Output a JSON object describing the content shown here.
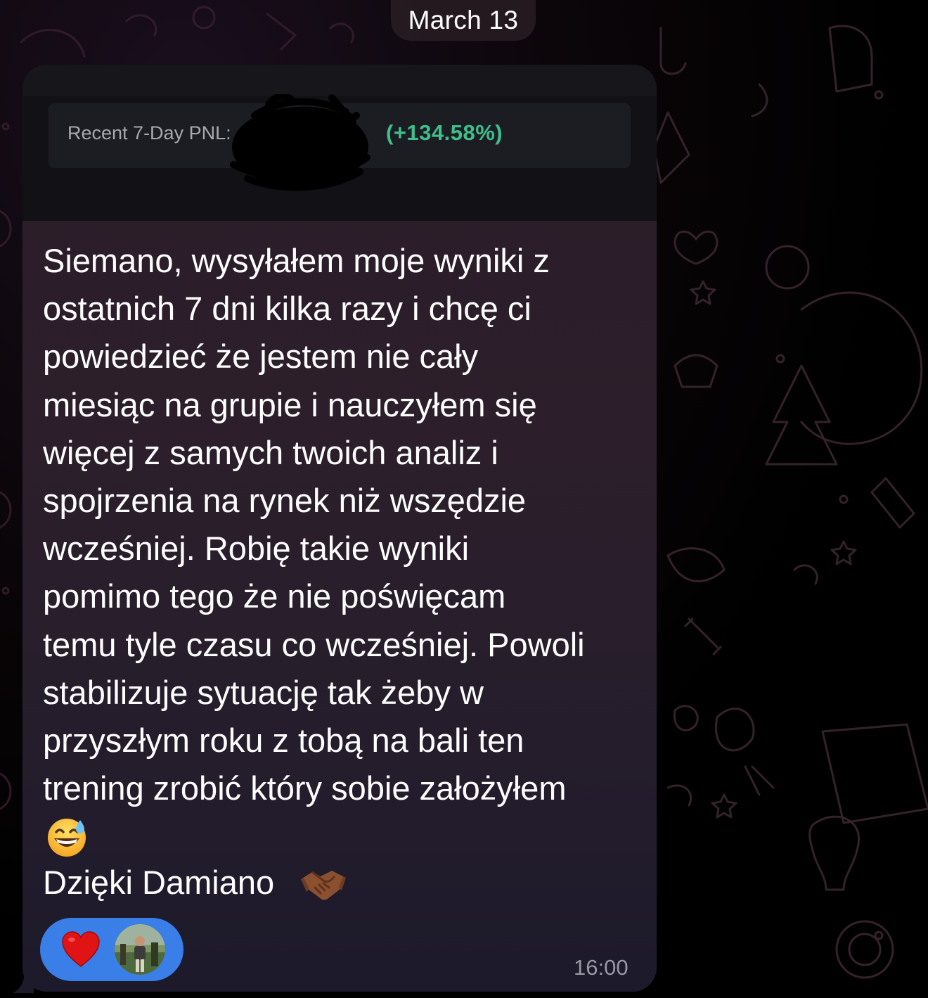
{
  "chat": {
    "date_label": "March 13"
  },
  "message": {
    "attachment": {
      "pnl_label": "Recent 7-Day PNL:",
      "pnl_percent": "(+134.58%)"
    },
    "text": "Siemano, wysyłałem moje wyniki z\nostatnich 7 dni kilka razy i chcę ci\npowiedzieć że jestem nie cały\nmiesiąc na grupie i nauczyłem się\nwięcej z samych twoich analiz i\nspojrzenia na rynek niż wszędzie\nwcześniej. Robię takie wyniki\npomimo tego że nie poświęcam\ntemu tyle czasu co wcześniej. Powoli\nstabilizuje sytuację tak żeby w\nprzyszłym roku z tobą na bali ten\ntrening zrobić który sobie założyłem",
    "emoji_1": "grinning-face-with-sweat-emoji",
    "thanks": "Dzięki Damiano",
    "emoji_2": "handshake-emoji",
    "time": "16:00"
  },
  "reactions": {
    "icon": "heart-icon",
    "color": "#3a7ee8"
  },
  "colors": {
    "pnl_positive": "#3fbf8a",
    "reaction_bg": "#3a7ee8"
  }
}
